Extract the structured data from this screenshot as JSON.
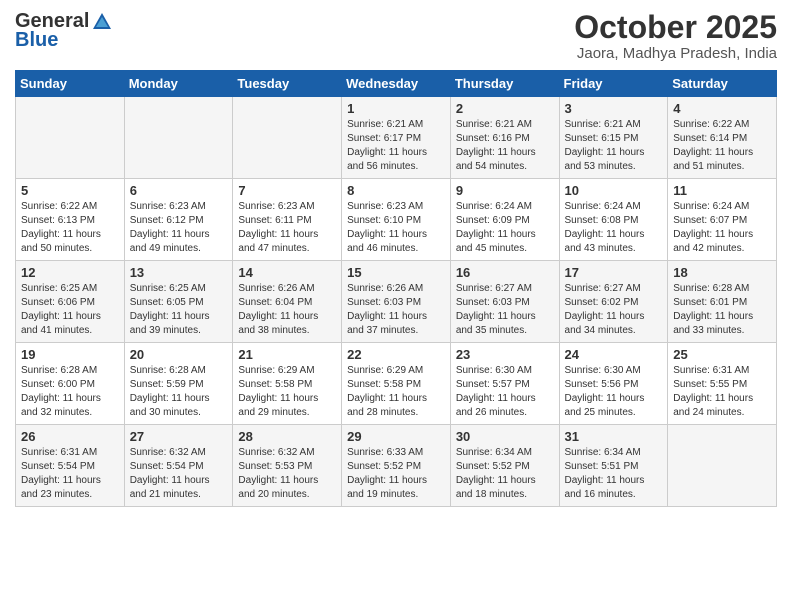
{
  "logo": {
    "general": "General",
    "blue": "Blue"
  },
  "header": {
    "month": "October 2025",
    "location": "Jaora, Madhya Pradesh, India"
  },
  "weekdays": [
    "Sunday",
    "Monday",
    "Tuesday",
    "Wednesday",
    "Thursday",
    "Friday",
    "Saturday"
  ],
  "weeks": [
    [
      {
        "day": "",
        "info": ""
      },
      {
        "day": "",
        "info": ""
      },
      {
        "day": "",
        "info": ""
      },
      {
        "day": "1",
        "info": "Sunrise: 6:21 AM\nSunset: 6:17 PM\nDaylight: 11 hours and 56 minutes."
      },
      {
        "day": "2",
        "info": "Sunrise: 6:21 AM\nSunset: 6:16 PM\nDaylight: 11 hours and 54 minutes."
      },
      {
        "day": "3",
        "info": "Sunrise: 6:21 AM\nSunset: 6:15 PM\nDaylight: 11 hours and 53 minutes."
      },
      {
        "day": "4",
        "info": "Sunrise: 6:22 AM\nSunset: 6:14 PM\nDaylight: 11 hours and 51 minutes."
      }
    ],
    [
      {
        "day": "5",
        "info": "Sunrise: 6:22 AM\nSunset: 6:13 PM\nDaylight: 11 hours and 50 minutes."
      },
      {
        "day": "6",
        "info": "Sunrise: 6:23 AM\nSunset: 6:12 PM\nDaylight: 11 hours and 49 minutes."
      },
      {
        "day": "7",
        "info": "Sunrise: 6:23 AM\nSunset: 6:11 PM\nDaylight: 11 hours and 47 minutes."
      },
      {
        "day": "8",
        "info": "Sunrise: 6:23 AM\nSunset: 6:10 PM\nDaylight: 11 hours and 46 minutes."
      },
      {
        "day": "9",
        "info": "Sunrise: 6:24 AM\nSunset: 6:09 PM\nDaylight: 11 hours and 45 minutes."
      },
      {
        "day": "10",
        "info": "Sunrise: 6:24 AM\nSunset: 6:08 PM\nDaylight: 11 hours and 43 minutes."
      },
      {
        "day": "11",
        "info": "Sunrise: 6:24 AM\nSunset: 6:07 PM\nDaylight: 11 hours and 42 minutes."
      }
    ],
    [
      {
        "day": "12",
        "info": "Sunrise: 6:25 AM\nSunset: 6:06 PM\nDaylight: 11 hours and 41 minutes."
      },
      {
        "day": "13",
        "info": "Sunrise: 6:25 AM\nSunset: 6:05 PM\nDaylight: 11 hours and 39 minutes."
      },
      {
        "day": "14",
        "info": "Sunrise: 6:26 AM\nSunset: 6:04 PM\nDaylight: 11 hours and 38 minutes."
      },
      {
        "day": "15",
        "info": "Sunrise: 6:26 AM\nSunset: 6:03 PM\nDaylight: 11 hours and 37 minutes."
      },
      {
        "day": "16",
        "info": "Sunrise: 6:27 AM\nSunset: 6:03 PM\nDaylight: 11 hours and 35 minutes."
      },
      {
        "day": "17",
        "info": "Sunrise: 6:27 AM\nSunset: 6:02 PM\nDaylight: 11 hours and 34 minutes."
      },
      {
        "day": "18",
        "info": "Sunrise: 6:28 AM\nSunset: 6:01 PM\nDaylight: 11 hours and 33 minutes."
      }
    ],
    [
      {
        "day": "19",
        "info": "Sunrise: 6:28 AM\nSunset: 6:00 PM\nDaylight: 11 hours and 32 minutes."
      },
      {
        "day": "20",
        "info": "Sunrise: 6:28 AM\nSunset: 5:59 PM\nDaylight: 11 hours and 30 minutes."
      },
      {
        "day": "21",
        "info": "Sunrise: 6:29 AM\nSunset: 5:58 PM\nDaylight: 11 hours and 29 minutes."
      },
      {
        "day": "22",
        "info": "Sunrise: 6:29 AM\nSunset: 5:58 PM\nDaylight: 11 hours and 28 minutes."
      },
      {
        "day": "23",
        "info": "Sunrise: 6:30 AM\nSunset: 5:57 PM\nDaylight: 11 hours and 26 minutes."
      },
      {
        "day": "24",
        "info": "Sunrise: 6:30 AM\nSunset: 5:56 PM\nDaylight: 11 hours and 25 minutes."
      },
      {
        "day": "25",
        "info": "Sunrise: 6:31 AM\nSunset: 5:55 PM\nDaylight: 11 hours and 24 minutes."
      }
    ],
    [
      {
        "day": "26",
        "info": "Sunrise: 6:31 AM\nSunset: 5:54 PM\nDaylight: 11 hours and 23 minutes."
      },
      {
        "day": "27",
        "info": "Sunrise: 6:32 AM\nSunset: 5:54 PM\nDaylight: 11 hours and 21 minutes."
      },
      {
        "day": "28",
        "info": "Sunrise: 6:32 AM\nSunset: 5:53 PM\nDaylight: 11 hours and 20 minutes."
      },
      {
        "day": "29",
        "info": "Sunrise: 6:33 AM\nSunset: 5:52 PM\nDaylight: 11 hours and 19 minutes."
      },
      {
        "day": "30",
        "info": "Sunrise: 6:34 AM\nSunset: 5:52 PM\nDaylight: 11 hours and 18 minutes."
      },
      {
        "day": "31",
        "info": "Sunrise: 6:34 AM\nSunset: 5:51 PM\nDaylight: 11 hours and 16 minutes."
      },
      {
        "day": "",
        "info": ""
      }
    ]
  ]
}
